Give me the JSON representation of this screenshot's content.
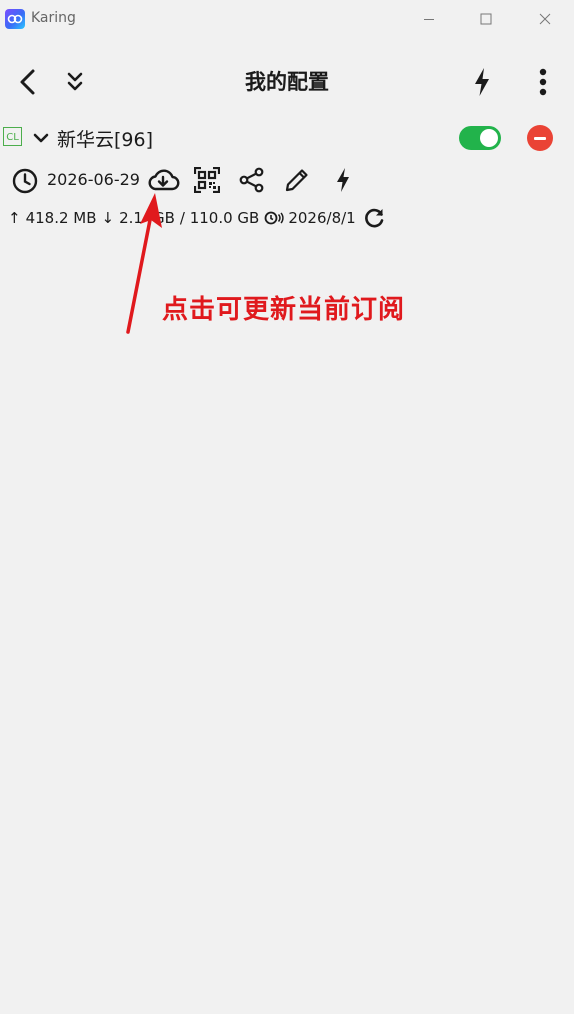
{
  "window": {
    "title": "Karing"
  },
  "header": {
    "title": "我的配置"
  },
  "profile": {
    "badge": "CL",
    "name": "新华云[96]",
    "enabled": true,
    "update_date": "2026-06-29"
  },
  "traffic": {
    "upload": "418.2 MB",
    "download": "2.1",
    "download_hidden_tail": "GB",
    "total": "/ 110.0 GB",
    "expire": "2026/8/1"
  },
  "annotation": {
    "text": "点击可更新当前订阅"
  },
  "colors": {
    "toggle_on": "#22b34b",
    "remove": "#ea4335",
    "badge": "#4cae4c",
    "annotation": "#e0191d",
    "background": "#f1f1f1"
  },
  "icons": {
    "back": "chevron-left-icon",
    "collapse": "double-chevron-down-icon",
    "flash": "lightning-icon",
    "more": "more-vertical-icon",
    "clock": "clock-icon",
    "cloud_download": "cloud-download-icon",
    "qr": "qr-code-icon",
    "share": "share-icon",
    "edit": "pencil-icon",
    "speed": "lightning-icon",
    "refresh": "refresh-icon"
  }
}
